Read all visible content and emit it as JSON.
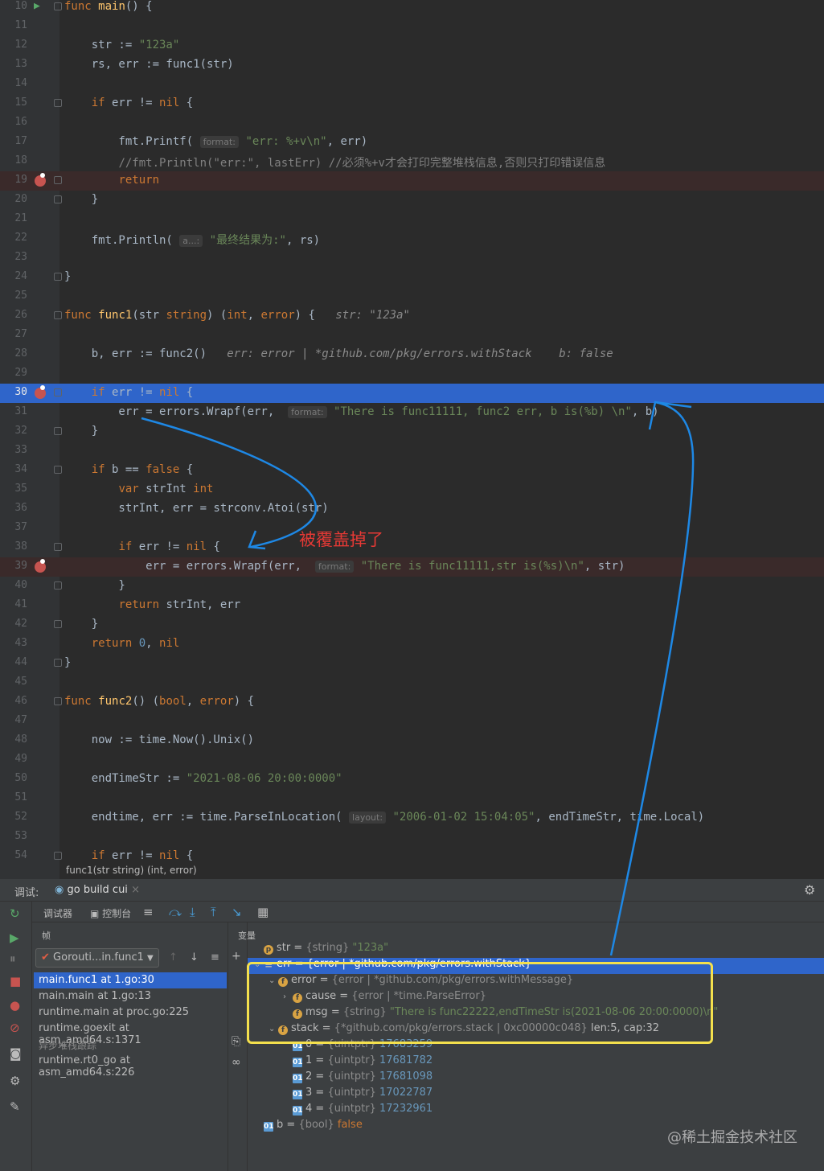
{
  "editor": {
    "lines": [
      {
        "n": "10",
        "html": "<span class='kw'>func</span> <span class='fn'>main</span>() {"
      },
      {
        "n": "11",
        "html": ""
      },
      {
        "n": "12",
        "html": "    str := <span class='str'>\"123a\"</span>"
      },
      {
        "n": "13",
        "html": "    rs, err := func1(str)"
      },
      {
        "n": "14",
        "html": ""
      },
      {
        "n": "15",
        "html": "    <span class='kw'>if</span> err != <span class='kw'>nil</span> {"
      },
      {
        "n": "16",
        "html": ""
      },
      {
        "n": "17",
        "html": "        fmt.Printf( <span class='hint'>format:</span> <span class='str'>\"err: %+v\\n\"</span>, err)"
      },
      {
        "n": "18",
        "html": "        <span class='cm'>//fmt.Println(\"err:\", lastErr) //必须%+v才会打印完整堆栈信息,否则只打印错误信息</span>"
      },
      {
        "n": "19",
        "html": "        <span class='kw'>return</span>"
      },
      {
        "n": "20",
        "html": "    }"
      },
      {
        "n": "21",
        "html": ""
      },
      {
        "n": "22",
        "html": "    fmt.Println( <span class='hint'>a...:</span> <span class='str'>\"最终结果为:\"</span>, rs)"
      },
      {
        "n": "23",
        "html": ""
      },
      {
        "n": "24",
        "html": "}"
      },
      {
        "n": "25",
        "html": ""
      },
      {
        "n": "26",
        "html": "<span class='kw'>func</span> <span class='fn'>func1</span>(str <span class='kw'>string</span>) (<span class='kw'>int</span>, <span class='kw'>error</span>) {   <span class='inl'>str: \"123a\"</span>"
      },
      {
        "n": "27",
        "html": ""
      },
      {
        "n": "28",
        "html": "    b, err := func2()   <span class='inl'>err: error | *github.com/pkg/errors.withStack    b: false</span>"
      },
      {
        "n": "29",
        "html": ""
      },
      {
        "n": "30",
        "html": "    <span class='kw'>if</span> err != <span class='kw'>nil</span> {"
      },
      {
        "n": "31",
        "html": "        err = errors.Wrapf(err,  <span class='hint'>format:</span> <span class='str'>\"There is func11111, func2 err, b is(%b) \\n\"</span>, b)"
      },
      {
        "n": "32",
        "html": "    }"
      },
      {
        "n": "33",
        "html": ""
      },
      {
        "n": "34",
        "html": "    <span class='kw'>if</span> b == <span class='kw'>false</span> {"
      },
      {
        "n": "35",
        "html": "        <span class='kw'>var</span> strInt <span class='kw'>int</span>"
      },
      {
        "n": "36",
        "html": "        strInt, err = strconv.Atoi(str)"
      },
      {
        "n": "37",
        "html": ""
      },
      {
        "n": "38",
        "html": "        <span class='kw'>if</span> err != <span class='kw'>nil</span> {"
      },
      {
        "n": "39",
        "html": "            err = errors.Wrapf(err,  <span class='hint'>format:</span> <span class='str'>\"There is func11111,str is(%s)\\n\"</span>, str)"
      },
      {
        "n": "40",
        "html": "        }"
      },
      {
        "n": "41",
        "html": "        <span class='kw'>return</span> strInt, err"
      },
      {
        "n": "42",
        "html": "    }"
      },
      {
        "n": "43",
        "html": "    <span class='kw'>return</span> <span class='num'>0</span>, <span class='kw'>nil</span>"
      },
      {
        "n": "44",
        "html": "}"
      },
      {
        "n": "45",
        "html": ""
      },
      {
        "n": "46",
        "html": "<span class='kw'>func</span> <span class='fn'>func2</span>() (<span class='kw'>bool</span>, <span class='kw'>error</span>) {"
      },
      {
        "n": "47",
        "html": ""
      },
      {
        "n": "48",
        "html": "    now := time.Now().Unix()"
      },
      {
        "n": "49",
        "html": ""
      },
      {
        "n": "50",
        "html": "    endTimeStr := <span class='str'>\"2021-08-06 20:00:0000\"</span>"
      },
      {
        "n": "51",
        "html": ""
      },
      {
        "n": "52",
        "html": "    endtime, err := time.ParseInLocation( <span class='hint'>layout:</span> <span class='str'>\"2006-01-02 15:04:05\"</span>, endTimeStr, time.Local)"
      },
      {
        "n": "53",
        "html": ""
      },
      {
        "n": "54",
        "html": "    <span class='kw'>if</span> err != <span class='kw'>nil</span> {"
      }
    ],
    "breakpoint_lines": [
      "19",
      "30",
      "39"
    ],
    "highlight_red_lines": [
      "19",
      "39"
    ],
    "current_line": "30",
    "breadcrumb": "func1(str string) (int, error)"
  },
  "annotation": "被覆盖掉了",
  "debug": {
    "label": "调试:",
    "config": "go build cui",
    "tab_debugger": "调试器",
    "tab_console": "控制台",
    "frames_header": "帧",
    "goroutine": "Gorouti...in.func1",
    "frames": [
      {
        "text": "main.func1 at 1.go:30",
        "active": true,
        "group": false
      },
      {
        "text": "main.main at 1.go:13",
        "active": false,
        "group": false
      },
      {
        "text": "runtime.main at proc.go:225",
        "active": false,
        "group": false
      },
      {
        "text": "runtime.goexit at asm_amd64.s:1371",
        "active": false,
        "group": false
      },
      {
        "text": "异步堆栈跟踪",
        "active": false,
        "group": true
      },
      {
        "text": "runtime.rt0_go at asm_amd64.s:226",
        "active": false,
        "group": false
      }
    ],
    "vars_header": "变量",
    "variables": [
      {
        "indent": 0,
        "icon": "p",
        "html": "str = <span class='ty'>{string}</span> <span class='vs'>\"123a\"</span>",
        "arrow": "",
        "active": false
      },
      {
        "indent": 0,
        "icon": "lst",
        "html": "err = {error | *github.com/pkg/errors.withStack}",
        "arrow": "v",
        "active": true
      },
      {
        "indent": 1,
        "icon": "f",
        "html": "error = <span class='ty'>{error | *github.com/pkg/errors.withMessage}</span>",
        "arrow": "v",
        "active": false
      },
      {
        "indent": 2,
        "icon": "f",
        "html": "cause = <span class='ty'>{error | *time.ParseError}</span>",
        "arrow": ">",
        "active": false
      },
      {
        "indent": 2,
        "icon": "f",
        "html": "msg = <span class='ty'>{string}</span> <span class='vs'>\"There is func22222,endTimeStr is(2021-08-06 20:00:0000)\\n\"</span>",
        "arrow": "",
        "active": false
      },
      {
        "indent": 1,
        "icon": "f",
        "html": "stack = <span class='ty'>{*github.com/pkg/errors.stack | 0xc00000c048}</span> len:5, cap:32",
        "arrow": "v",
        "active": false
      },
      {
        "indent": 2,
        "icon": "01",
        "html": "0 = <span class='ty'>{uintptr}</span> <span class='vn'>17683259</span>",
        "arrow": "",
        "active": false
      },
      {
        "indent": 2,
        "icon": "01",
        "html": "1 = <span class='ty'>{uintptr}</span> <span class='vn'>17681782</span>",
        "arrow": "",
        "active": false
      },
      {
        "indent": 2,
        "icon": "01",
        "html": "2 = <span class='ty'>{uintptr}</span> <span class='vn'>17681098</span>",
        "arrow": "",
        "active": false
      },
      {
        "indent": 2,
        "icon": "01",
        "html": "3 = <span class='ty'>{uintptr}</span> <span class='vn'>17022787</span>",
        "arrow": "",
        "active": false
      },
      {
        "indent": 2,
        "icon": "01",
        "html": "4 = <span class='ty'>{uintptr}</span> <span class='vn'>17232961</span>",
        "arrow": "",
        "active": false
      },
      {
        "indent": 0,
        "icon": "01",
        "html": "b = <span class='ty'>{bool}</span> <span class='vb'>false</span>",
        "arrow": "",
        "active": false
      }
    ]
  },
  "watermark": "@稀土掘金技术社区",
  "colors": {
    "accent": "#2f65ca",
    "breakpoint": "#c75450",
    "annotation": "#e53935",
    "arrow": "#1e88e5",
    "highlight_box": "#f4e04d"
  }
}
